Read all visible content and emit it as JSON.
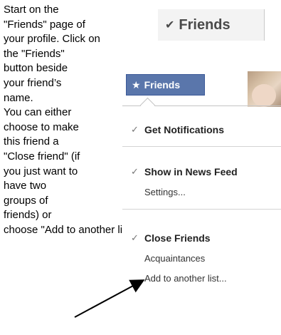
{
  "instructions": {
    "lines": [
      "Start on the",
      "\"Friends\" page of",
      "your profile. Click on",
      "the \"Friends\"",
      "button beside",
      "your friend’s",
      "name.",
      "You can either",
      "choose to make",
      "this friend a",
      "\"Close friend\" (if",
      "you just want to",
      "have two",
      "groups of",
      "friends) or",
      "choose \"Add to another list\"."
    ]
  },
  "top_button": {
    "check": "✔",
    "label": "Friends"
  },
  "menu": {
    "friends_button": {
      "icon": "star-icon",
      "glyph": "★",
      "label": "Friends"
    },
    "check_glyph": "✓",
    "items": [
      {
        "label": "Get Notifications",
        "checked": true,
        "bold": true
      },
      {
        "label": "Show in News Feed",
        "checked": true,
        "bold": true
      },
      {
        "label": "Settings...",
        "checked": false,
        "bold": false
      },
      {
        "label": "Close Friends",
        "checked": true,
        "bold": true
      },
      {
        "label": "Acquaintances",
        "checked": false,
        "bold": false
      },
      {
        "label": "Add to another list...",
        "checked": false,
        "bold": false
      }
    ]
  },
  "colors": {
    "fb_blue": "#5a76ab",
    "fb_border": "#3b5998"
  }
}
